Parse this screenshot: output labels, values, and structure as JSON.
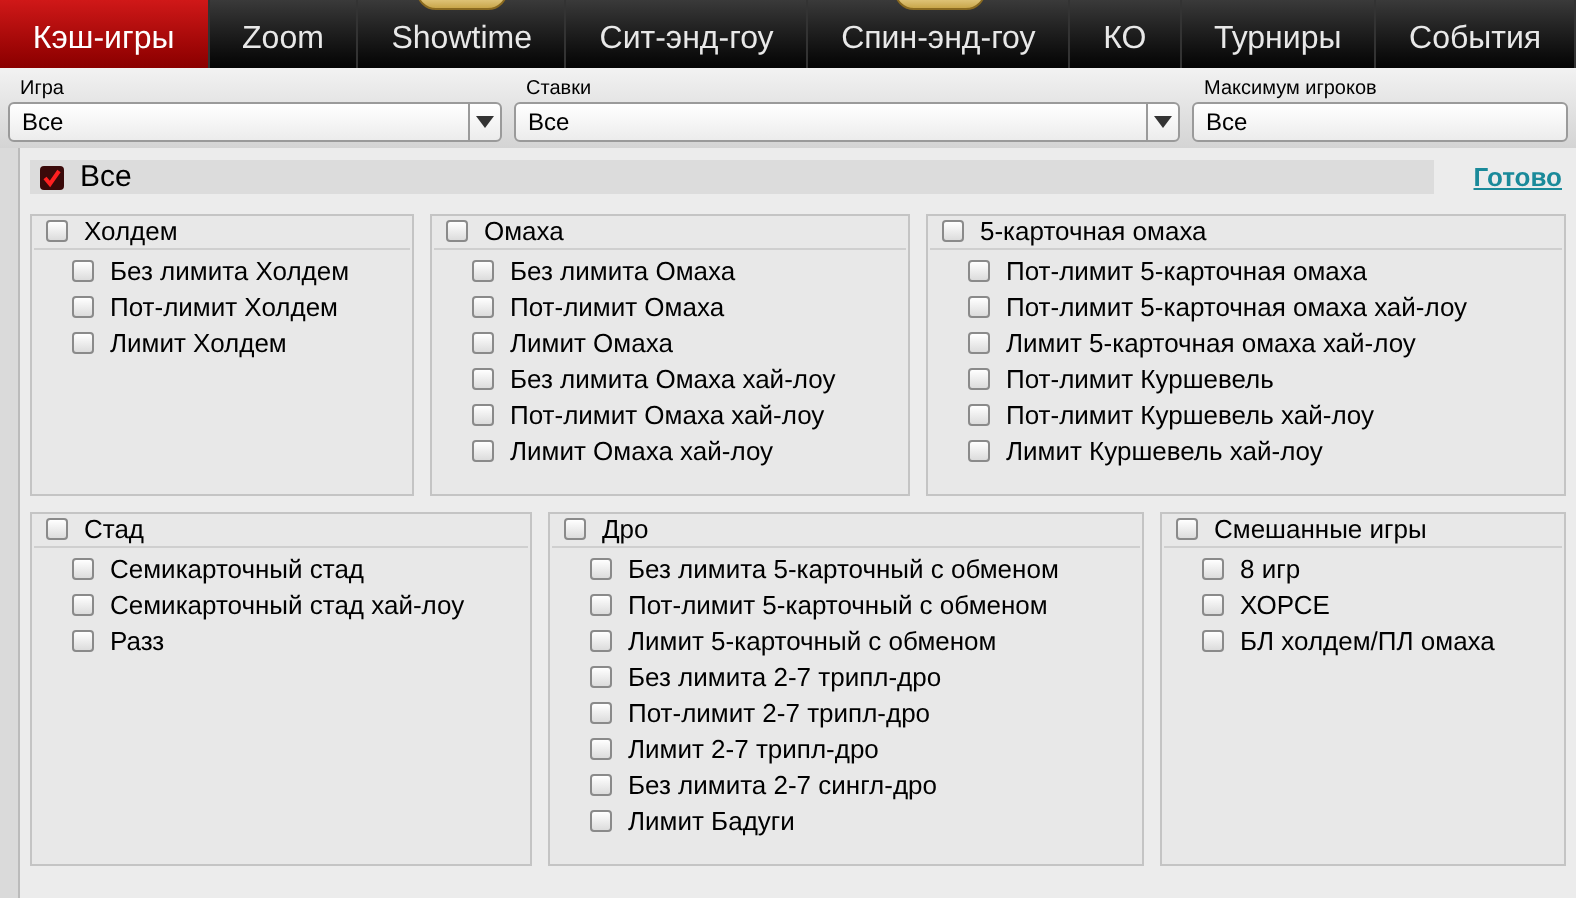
{
  "tabs": [
    {
      "label": "Кэш-игры",
      "selected": true,
      "badge": false
    },
    {
      "label": "Zoom",
      "selected": false,
      "badge": false
    },
    {
      "label": "Showtime",
      "selected": false,
      "badge": true
    },
    {
      "label": "Сит-энд-гоу",
      "selected": false,
      "badge": false
    },
    {
      "label": "Спин-энд-гоу",
      "selected": false,
      "badge": true
    },
    {
      "label": "КО",
      "selected": false,
      "badge": false
    },
    {
      "label": "Турниры",
      "selected": false,
      "badge": false
    },
    {
      "label": "События",
      "selected": false,
      "badge": false
    }
  ],
  "filters": [
    {
      "label": "Игра",
      "value": "Все",
      "dropdown": true
    },
    {
      "label": "Ставки",
      "value": "Все",
      "dropdown": true
    },
    {
      "label": "Максимум игроков",
      "value": "Все",
      "dropdown": false
    }
  ],
  "all": {
    "label": "Все",
    "checked": true
  },
  "done_link": "Готово",
  "group_rows": [
    [
      {
        "title": "Холдем",
        "checked": false,
        "items": [
          {
            "label": "Без лимита Холдем",
            "checked": false
          },
          {
            "label": "Пот-лимит Холдем",
            "checked": false
          },
          {
            "label": "Лимит Холдем",
            "checked": false
          }
        ]
      },
      {
        "title": "Омаха",
        "checked": false,
        "items": [
          {
            "label": "Без лимита Омаха",
            "checked": false
          },
          {
            "label": "Пот-лимит Омаха",
            "checked": false
          },
          {
            "label": "Лимит Омаха",
            "checked": false
          },
          {
            "label": "Без лимита Омаха хай-лоу",
            "checked": false
          },
          {
            "label": "Пот-лимит Омаха хай-лоу",
            "checked": false
          },
          {
            "label": "Лимит Омаха хай-лоу",
            "checked": false
          }
        ]
      },
      {
        "title": "5-карточная омаха",
        "checked": false,
        "items": [
          {
            "label": "Пот-лимит 5-карточная омаха",
            "checked": false
          },
          {
            "label": "Пот-лимит 5-карточная омаха хай-лоу",
            "checked": false
          },
          {
            "label": "Лимит 5-карточная омаха хай-лоу",
            "checked": false
          },
          {
            "label": "Пот-лимит Куршевель",
            "checked": false
          },
          {
            "label": "Пот-лимит Куршевель хай-лоу",
            "checked": false
          },
          {
            "label": "Лимит Куршевель хай-лоу",
            "checked": false
          }
        ]
      }
    ],
    [
      {
        "title": "Стад",
        "checked": false,
        "items": [
          {
            "label": "Семикарточный стад",
            "checked": false
          },
          {
            "label": "Семикарточный стад хай-лоу",
            "checked": false
          },
          {
            "label": "Разз",
            "checked": false
          }
        ]
      },
      {
        "title": "Дро",
        "checked": false,
        "items": [
          {
            "label": "Без лимита 5-карточный с обменом",
            "checked": false
          },
          {
            "label": "Пот-лимит 5-карточный с обменом",
            "checked": false
          },
          {
            "label": "Лимит 5-карточный с обменом",
            "checked": false
          },
          {
            "label": "Без лимита 2-7 трипл-дро",
            "checked": false
          },
          {
            "label": "Пот-лимит 2-7 трипл-дро",
            "checked": false
          },
          {
            "label": "Лимит 2-7 трипл-дро",
            "checked": false
          },
          {
            "label": "Без лимита 2-7 сингл-дро",
            "checked": false
          },
          {
            "label": "Лимит Бадуги",
            "checked": false
          }
        ]
      },
      {
        "title": "Смешанные игры",
        "checked": false,
        "items": [
          {
            "label": "8 игр",
            "checked": false
          },
          {
            "label": "ХОРСЕ",
            "checked": false
          },
          {
            "label": "БЛ холдем/ПЛ омаха",
            "checked": false
          }
        ]
      }
    ]
  ]
}
